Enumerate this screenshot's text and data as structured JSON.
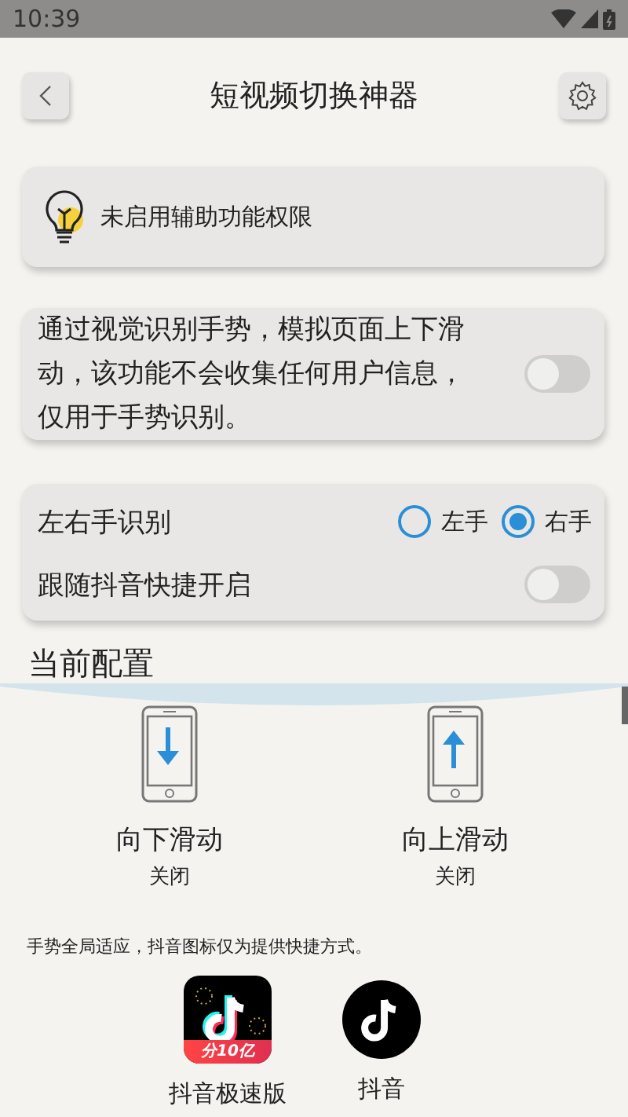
{
  "status_bar": {
    "time": "10:39"
  },
  "header": {
    "title": "短视频切换神器"
  },
  "permission_card": {
    "text": "未启用辅助功能权限"
  },
  "gesture_card": {
    "text": "通过视觉识别手势，模拟页面上下滑动，该功能不会收集任何用户信息，仅用于手势识别。",
    "on": false
  },
  "settings_card": {
    "hand_label": "左右手识别",
    "hand_options": [
      {
        "label": "左手",
        "selected": false
      },
      {
        "label": "右手",
        "selected": true
      }
    ],
    "follow_label": "跟随抖音快捷开启",
    "follow_on": false
  },
  "config": {
    "title": "当前配置",
    "gestures": [
      {
        "kind": "down",
        "label": "向下滑动",
        "status": "关闭"
      },
      {
        "kind": "up",
        "label": "向上滑动",
        "status": "关闭"
      }
    ]
  },
  "note": "手势全局适应，抖音图标仅为提供快捷方式。",
  "apps": [
    {
      "kind": "square",
      "name": "抖音极速版",
      "badge": "分10亿"
    },
    {
      "kind": "circle",
      "name": "抖音"
    }
  ]
}
